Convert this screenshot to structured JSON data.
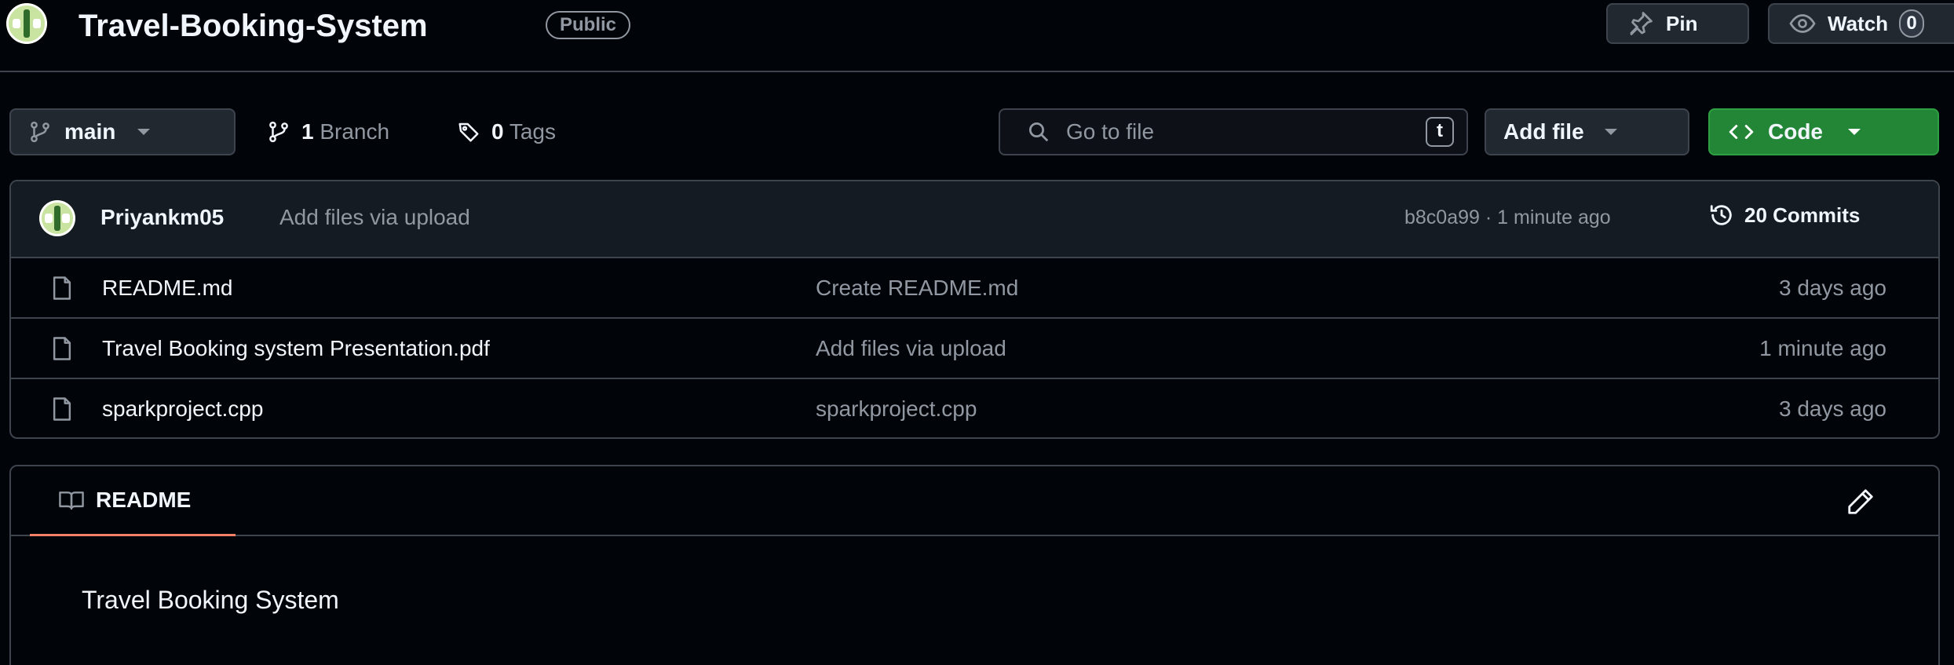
{
  "repo": {
    "name": "Travel-Booking-System",
    "visibility": "Public"
  },
  "header_actions": {
    "pin_label": "Pin",
    "watch_label": "Watch",
    "watch_count": "0"
  },
  "toolbar": {
    "branch_selected": "main",
    "branch_count": "1",
    "branch_label": "Branch",
    "tag_count": "0",
    "tag_label": "Tags",
    "search_placeholder": "Go to file",
    "search_shortcut": "t",
    "add_file_label": "Add file",
    "code_label": "Code",
    "code_accent": "#238636"
  },
  "latest_commit": {
    "author": "Priyankm05",
    "message": "Add files via upload",
    "hash_time": "b8c0a99 · 1 minute ago",
    "commits_count": "20",
    "commits_label": "Commits"
  },
  "files": [
    {
      "icon": "file-icon",
      "name": "README.md",
      "message": "Create README.md",
      "date": "3 days ago"
    },
    {
      "icon": "file-icon",
      "name": "Travel Booking system Presentation.pdf",
      "message": "Add files via upload",
      "date": "1 minute ago"
    },
    {
      "icon": "file-icon",
      "name": "sparkproject.cpp",
      "message": "sparkproject.cpp",
      "date": "3 days ago"
    }
  ],
  "readme": {
    "tab_label": "README",
    "content": "Travel Booking System",
    "tab_accent": "#f78166"
  }
}
